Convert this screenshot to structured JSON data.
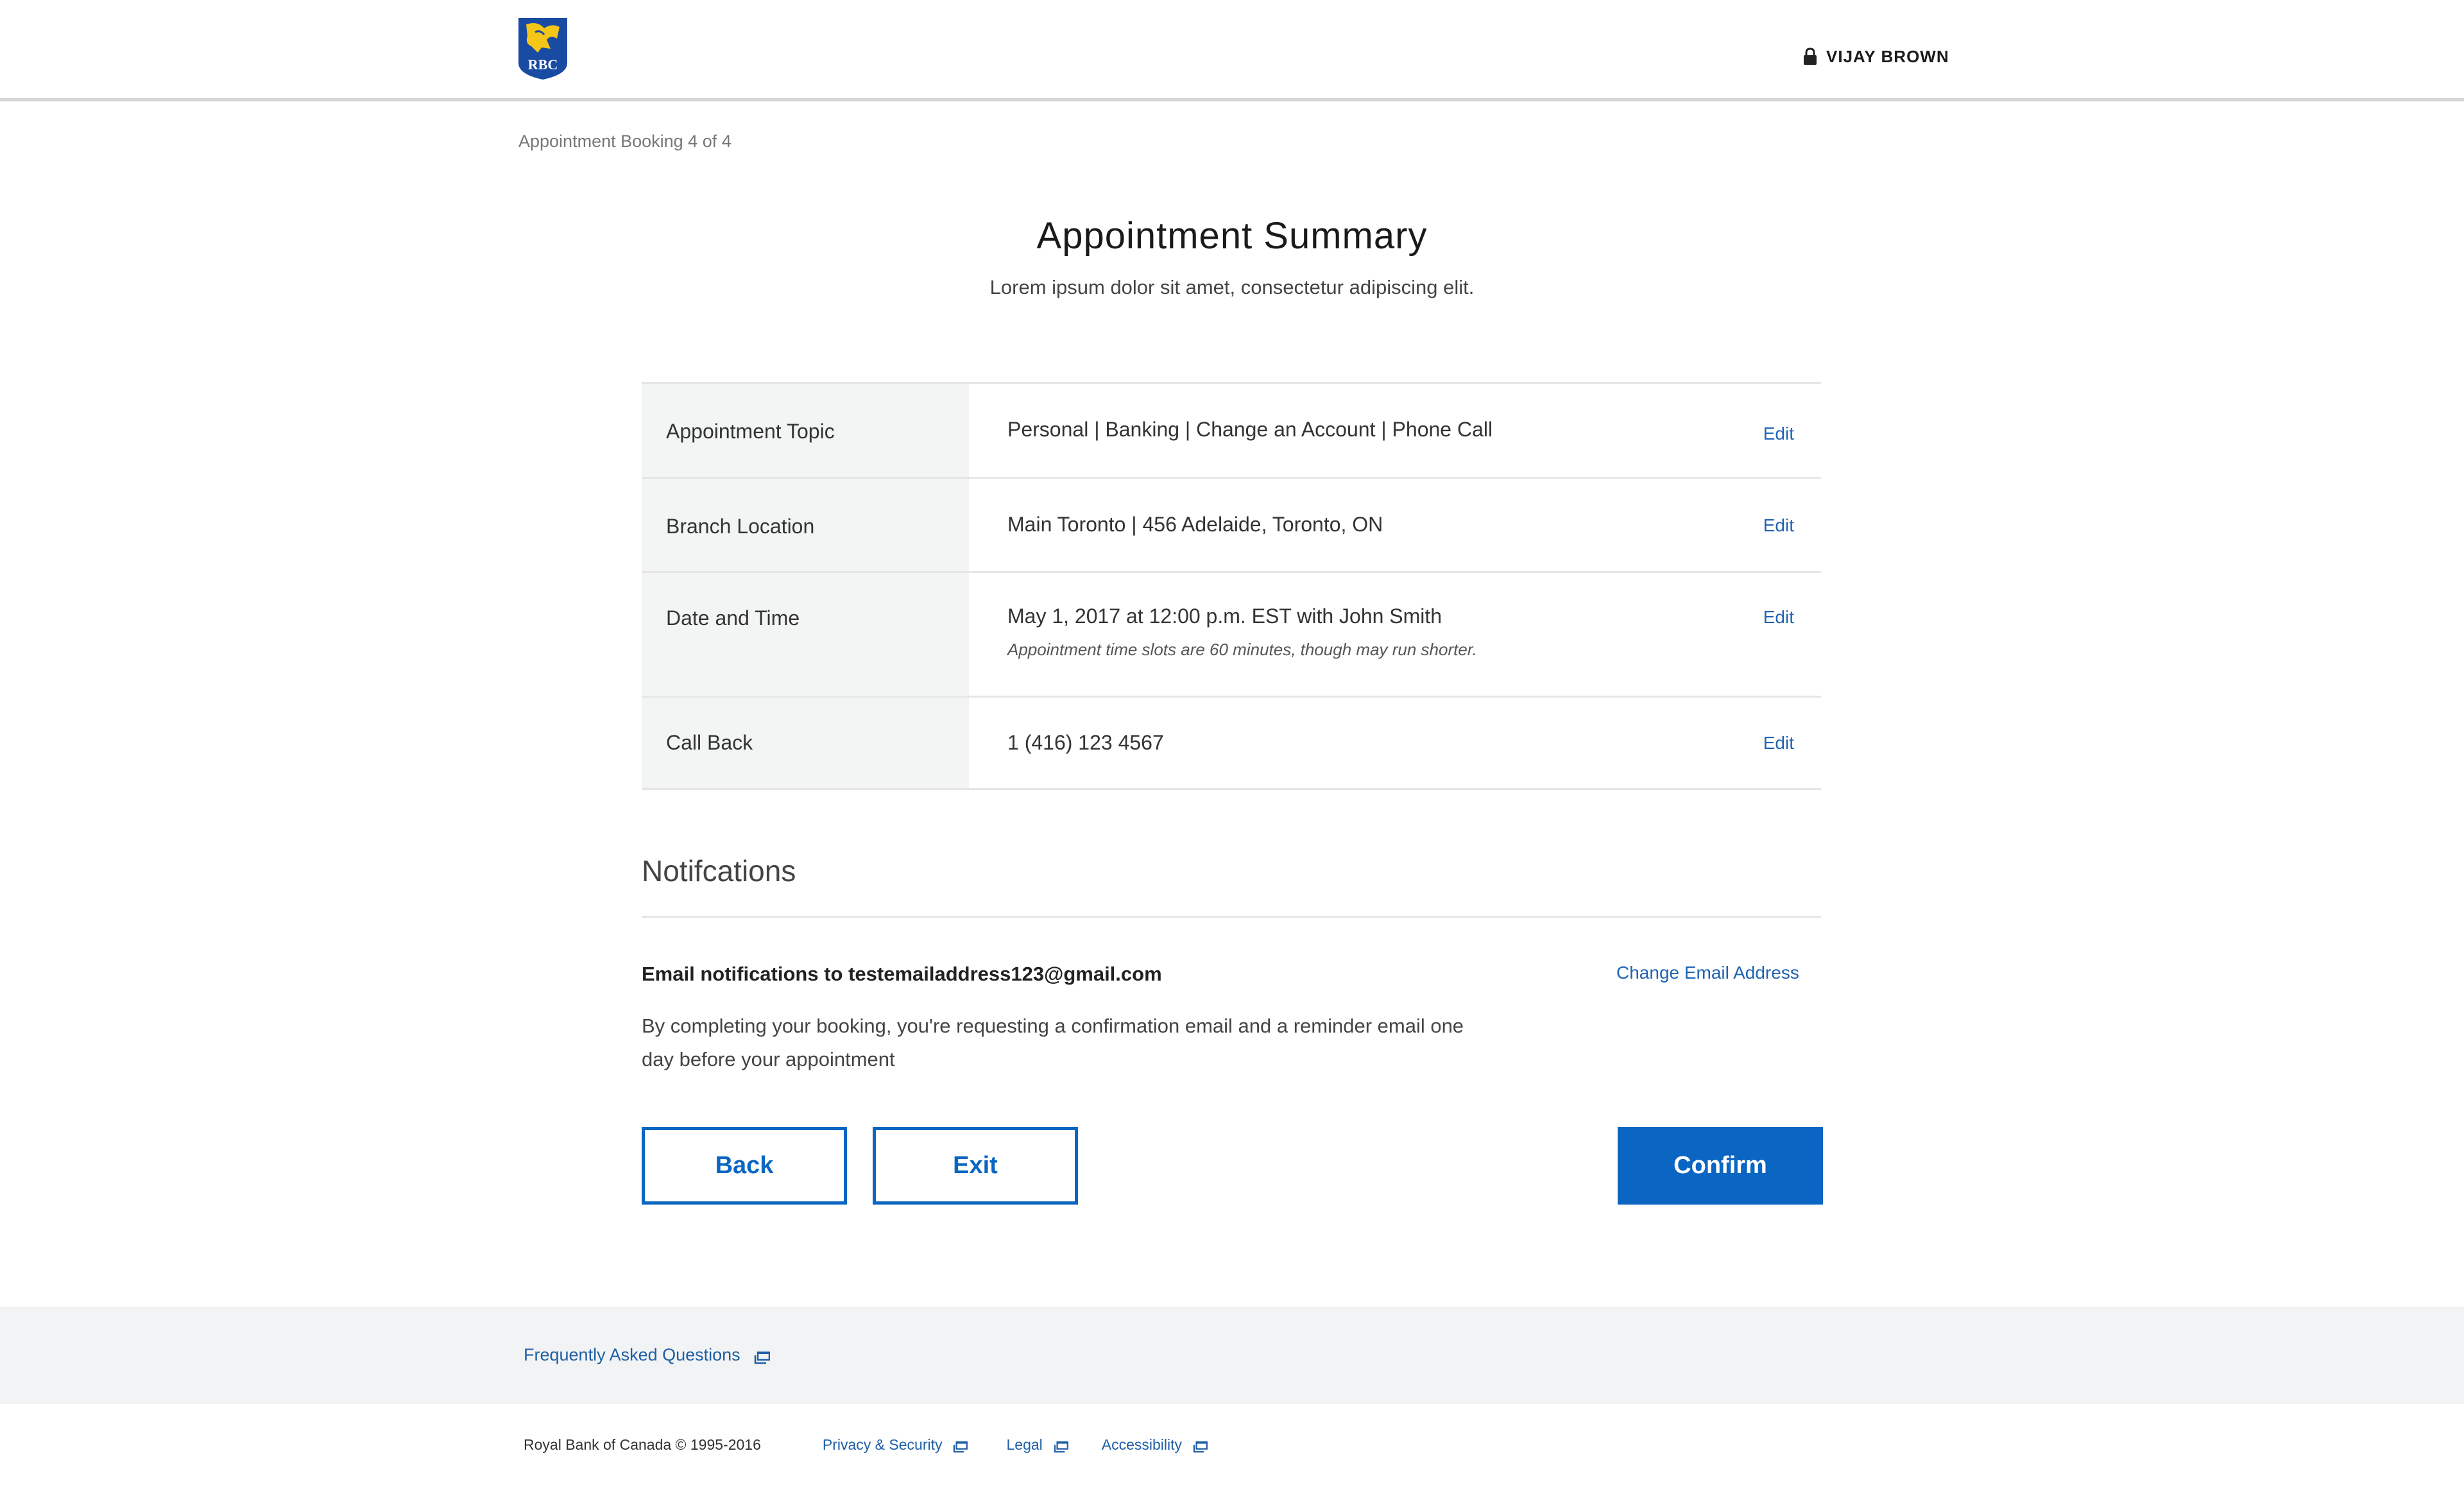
{
  "header": {
    "logo_text": "RBC",
    "user_name": "VIJAY BROWN"
  },
  "breadcrumb": "Appointment Booking 4 of 4",
  "title": "Appointment Summary",
  "subtitle": "Lorem ipsum dolor sit amet, consectetur adipiscing elit.",
  "summary": {
    "edit_label": "Edit",
    "rows": [
      {
        "label": "Appointment Topic",
        "value": "Personal | Banking | Change an Account | Phone Call"
      },
      {
        "label": "Branch Location",
        "value": "Main Toronto | 456 Adelaide, Toronto, ON"
      },
      {
        "label": "Date and Time",
        "value": "May 1, 2017 at 12:00 p.m. EST with John Smith",
        "note": "Appointment time slots are 60 minutes, though may run shorter."
      },
      {
        "label": "Call Back",
        "value": "1 (416) 123 4567"
      }
    ]
  },
  "notifications": {
    "title": "Notifcations",
    "email_line": "Email notifications to testemailaddress123@gmail.com",
    "change_email_label": "Change Email Address",
    "description": "By completing your booking, you're requesting a confirmation email and a reminder email one day before your appointment"
  },
  "buttons": {
    "back": "Back",
    "exit": "Exit",
    "confirm": "Confirm"
  },
  "footer": {
    "faq": "Frequently Asked Questions",
    "copyright": "Royal Bank of Canada © 1995-2016",
    "links": {
      "privacy": "Privacy & Security",
      "legal": "Legal",
      "accessibility": "Accessibility"
    }
  },
  "colors": {
    "brand_blue": "#0a66c2",
    "link_blue": "#1f63b4",
    "logo_blue": "#1a4ba3",
    "logo_gold": "#f5c518"
  }
}
